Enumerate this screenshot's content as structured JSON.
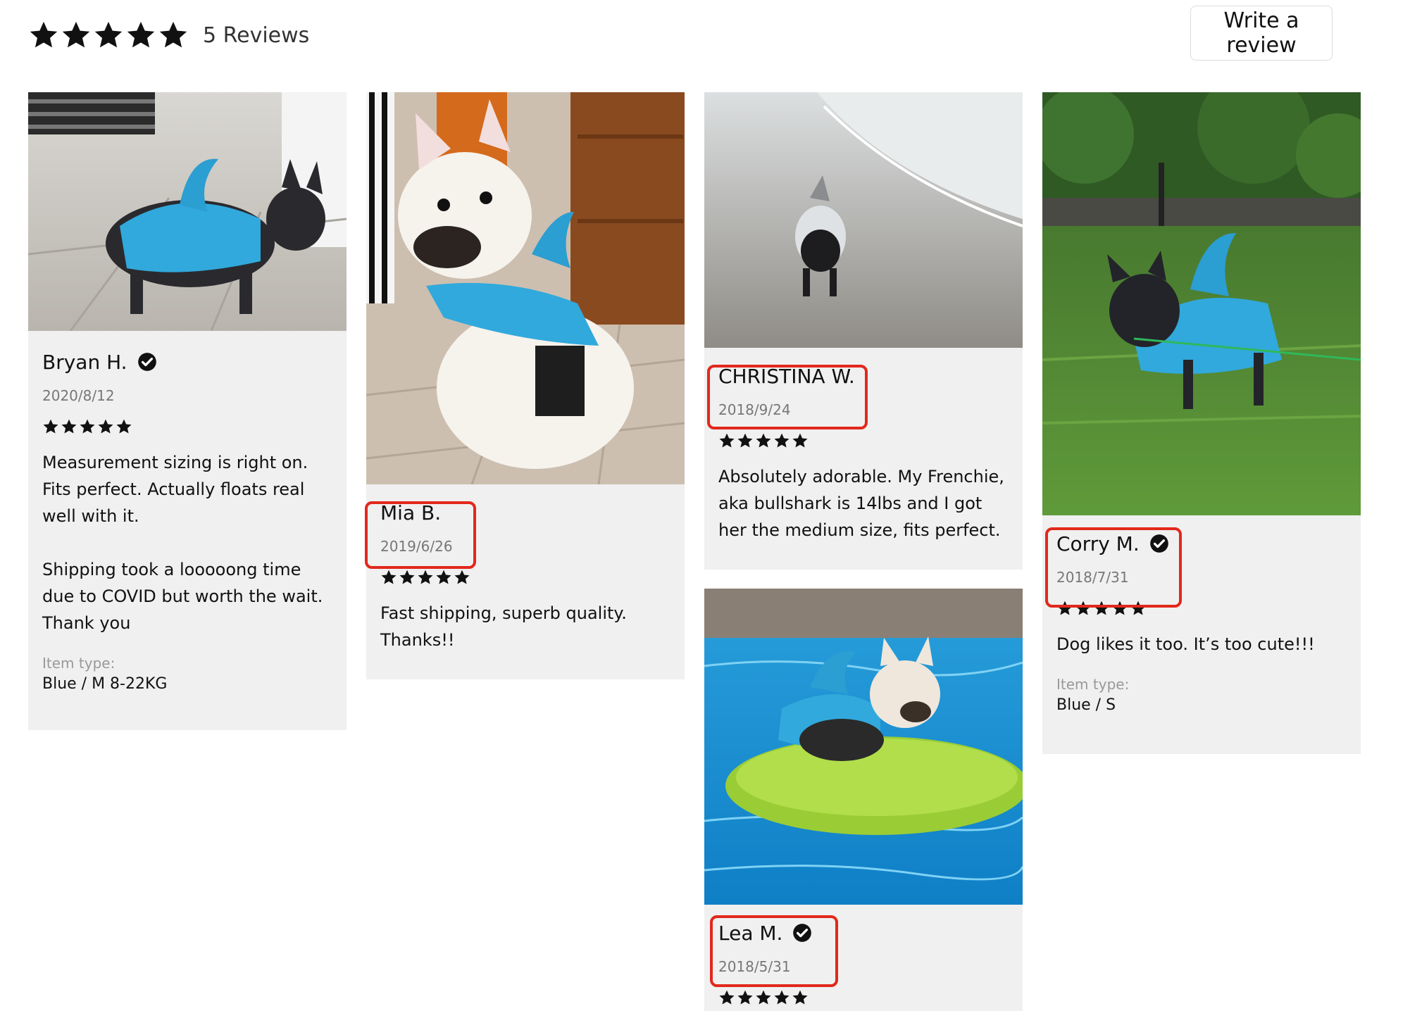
{
  "summary": {
    "count_label": "5 Reviews",
    "average_rating": 5,
    "max_rating": 5,
    "star_icon": "star-icon",
    "write_review_label": "Write a review"
  },
  "colors": {
    "star": "#111111",
    "card_bg": "#f0f0f0",
    "highlight": "#e2281c",
    "date": "#777777",
    "label": "#999999"
  },
  "reviews": [
    {
      "name": "Bryan H.",
      "verified": true,
      "date": "2020/8/12",
      "rating": 5,
      "text": "Measurement sizing is right on.\nFits perfect.    Actually floats real well with it.\n\nShipping took a looooong time due to COVID but worth the wait. Thank you",
      "item_type_label": "Item type:",
      "item_type_value": "Blue / M 8-22KG",
      "photo_icon": "dog-photo-icon"
    },
    {
      "name": "Mia B.",
      "verified": false,
      "date": "2019/6/26",
      "rating": 5,
      "text": "Fast shipping, superb quality. Thanks!!",
      "photo_icon": "dog-photo-icon"
    },
    {
      "name": "CHRISTINA W.",
      "verified": false,
      "date": "2018/9/24",
      "rating": 5,
      "text": "Absolutely adorable. My Frenchie, aka bullshark is 14lbs and I got her the medium size, fits perfect.",
      "photo_icon": "dog-photo-icon"
    },
    {
      "name": "Lea M.",
      "verified": true,
      "date": "2018/5/31",
      "rating": 5,
      "photo_icon": "dog-photo-icon"
    },
    {
      "name": "Corry M.",
      "verified": true,
      "date": "2018/7/31",
      "rating": 5,
      "text": "Dog likes it too. It’s too cute!!!",
      "item_type_label": "Item type:",
      "item_type_value": "Blue / S",
      "photo_icon": "dog-photo-icon"
    }
  ]
}
